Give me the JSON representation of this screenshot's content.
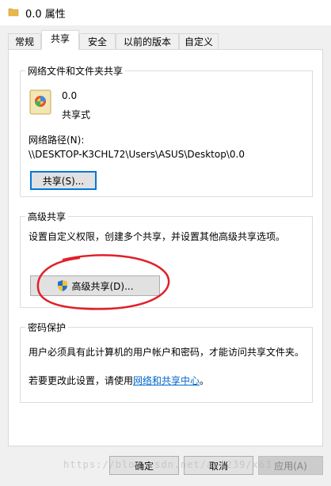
{
  "window": {
    "title": "0.0 属性"
  },
  "tabs": [
    {
      "label": "常规"
    },
    {
      "label": "共享"
    },
    {
      "label": "安全"
    },
    {
      "label": "以前的版本"
    },
    {
      "label": "自定义"
    }
  ],
  "active_tab": "共享",
  "network_share": {
    "title": "网络文件和文件夹共享",
    "folder_name": "0.0",
    "share_status": "共享式",
    "path_label": "网络路径(N):",
    "path_value": "\\\\DESKTOP-K3CHL72\\Users\\ASUS\\Desktop\\0.0",
    "share_button": "共享(S)..."
  },
  "advanced_share": {
    "title": "高级共享",
    "description": "设置自定义权限，创建多个共享，并设置其他高级共享选项。",
    "button": "高级共享(D)..."
  },
  "password_protection": {
    "title": "密码保护",
    "description": "用户必须具有此计算机的用户帐户和密码，才能访问共享文件夹。",
    "change_prefix": "若要更改此设置，请使用",
    "link_text": "网络和共享中心",
    "change_suffix": "。"
  },
  "footer": {
    "ok": "确定",
    "cancel": "取消",
    "apply": "应用(A)"
  },
  "watermark": "https://blog.csdn.net/ai1239/x63",
  "colors": {
    "annotation": "#e0202a",
    "link": "#0066cc",
    "focus": "#0078d7"
  }
}
